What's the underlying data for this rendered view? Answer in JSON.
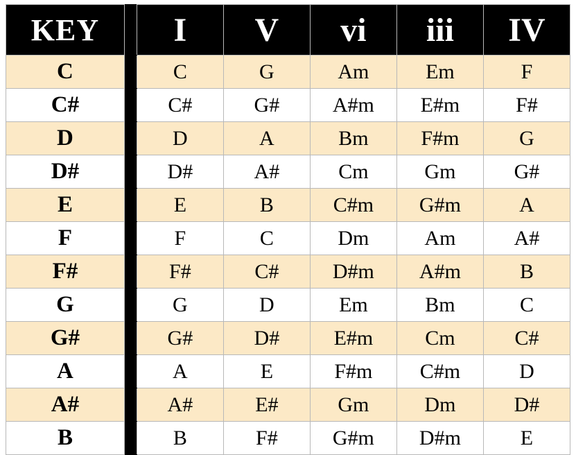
{
  "table": {
    "headers": [
      "KEY",
      "I",
      "V",
      "vi",
      "iii",
      "IV"
    ],
    "rows": [
      {
        "key": "C",
        "chords": [
          "C",
          "G",
          "Am",
          "Em",
          "F"
        ]
      },
      {
        "key": "C#",
        "chords": [
          "C#",
          "G#",
          "A#m",
          "E#m",
          "F#"
        ]
      },
      {
        "key": "D",
        "chords": [
          "D",
          "A",
          "Bm",
          "F#m",
          "G"
        ]
      },
      {
        "key": "D#",
        "chords": [
          "D#",
          "A#",
          "Cm",
          "Gm",
          "G#"
        ]
      },
      {
        "key": "E",
        "chords": [
          "E",
          "B",
          "C#m",
          "G#m",
          "A"
        ]
      },
      {
        "key": "F",
        "chords": [
          "F",
          "C",
          "Dm",
          "Am",
          "A#"
        ]
      },
      {
        "key": "F#",
        "chords": [
          "F#",
          "C#",
          "D#m",
          "A#m",
          "B"
        ]
      },
      {
        "key": "G",
        "chords": [
          "G",
          "D",
          "Em",
          "Bm",
          "C"
        ]
      },
      {
        "key": "G#",
        "chords": [
          "G#",
          "D#",
          "E#m",
          "Cm",
          "C#"
        ]
      },
      {
        "key": "A",
        "chords": [
          "A",
          "E",
          "F#m",
          "C#m",
          "D"
        ]
      },
      {
        "key": "A#",
        "chords": [
          "A#",
          "E#",
          "Gm",
          "Dm",
          "D#"
        ]
      },
      {
        "key": "B",
        "chords": [
          "B",
          "F#",
          "G#m",
          "D#m",
          "E"
        ]
      }
    ]
  }
}
